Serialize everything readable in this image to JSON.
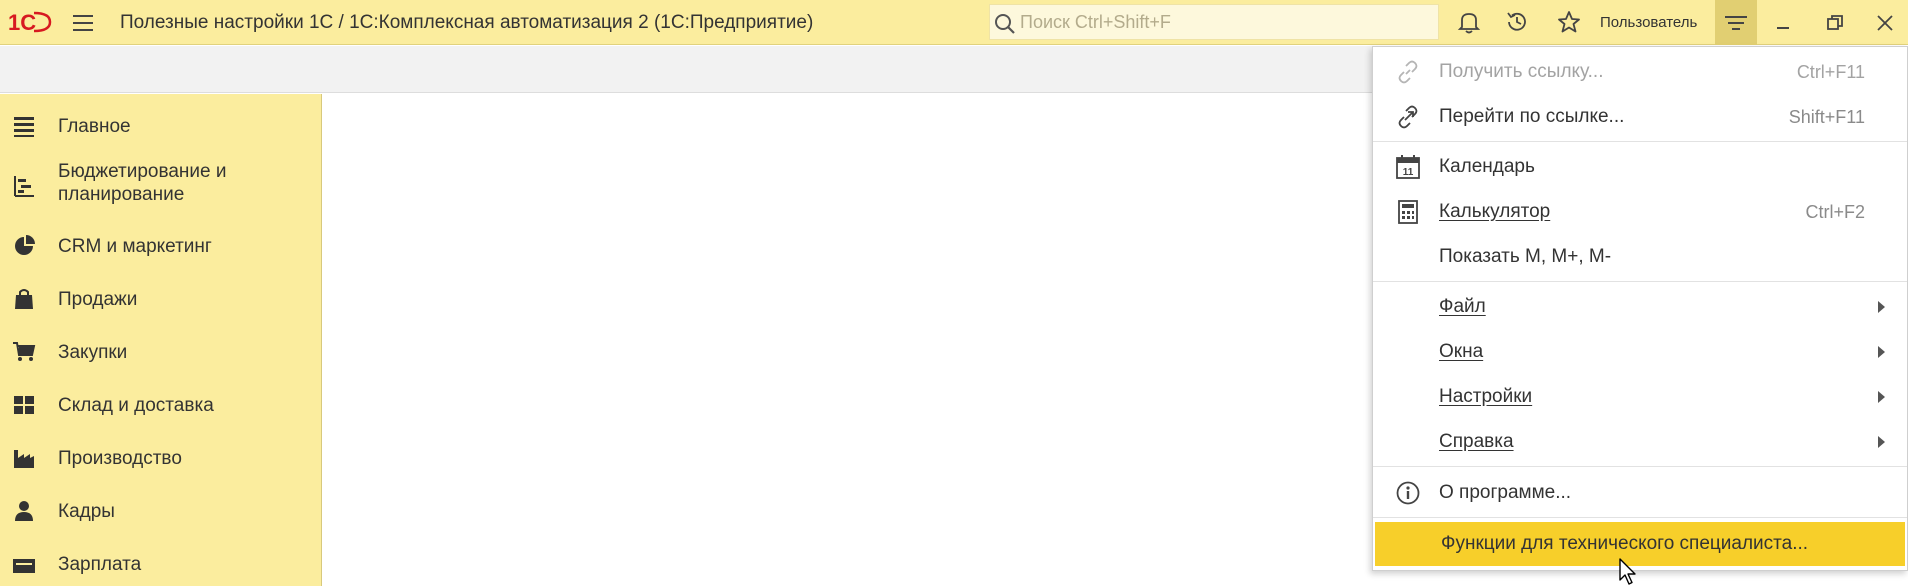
{
  "app": {
    "logo_text": "1С",
    "title": "Полезные настройки 1С / 1С:Комплексная автоматизация 2  (1С:Предприятие)"
  },
  "search": {
    "value": "",
    "placeholder": "Поиск Ctrl+Shift+F",
    "icon": "search-icon"
  },
  "toolbar": {
    "icons": [
      "bell-icon",
      "history-icon",
      "star-icon"
    ],
    "user_label": "Пользователь",
    "menu_icon": "main-menu-icon",
    "window_icons": [
      "minimize-icon",
      "restore-icon",
      "close-icon"
    ]
  },
  "sidebar": {
    "items": [
      {
        "label": "Главное",
        "icon": "list-icon"
      },
      {
        "label": "Бюджетирование и планирование",
        "icon": "budget-icon"
      },
      {
        "label": "CRM и маркетинг",
        "icon": "pie-chart-icon"
      },
      {
        "label": "Продажи",
        "icon": "shopping-bag-icon"
      },
      {
        "label": "Закупки",
        "icon": "cart-icon"
      },
      {
        "label": "Склад и доставка",
        "icon": "warehouse-icon"
      },
      {
        "label": "Производство",
        "icon": "factory-icon"
      },
      {
        "label": "Кадры",
        "icon": "person-icon"
      },
      {
        "label": "Зарплата",
        "icon": "money-icon"
      }
    ]
  },
  "menu": {
    "items": [
      {
        "label": "Получить ссылку...",
        "shortcut": "Ctrl+F11",
        "icon": "link-icon",
        "disabled": true
      },
      {
        "label": "Перейти по ссылке...",
        "shortcut": "Shift+F11",
        "icon": "follow-link-icon"
      },
      {
        "label": "Календарь",
        "shortcut": "",
        "icon": "calendar-icon",
        "calendar_day": "11"
      },
      {
        "label": "Калькулятор",
        "shortcut": "Ctrl+F2",
        "icon": "calculator-icon"
      },
      {
        "label": "Показать M, M+, M-",
        "shortcut": ""
      },
      {
        "label": "Файл",
        "submenu": true
      },
      {
        "label": "Окна",
        "submenu": true
      },
      {
        "label": "Настройки",
        "submenu": true
      },
      {
        "label": "Справка",
        "submenu": true
      },
      {
        "label": "О программе...",
        "icon": "info-icon"
      },
      {
        "label": "Функции для технического специалиста...",
        "highlighted": true
      }
    ]
  },
  "colors": {
    "title_bar": "#fbed9e",
    "sidebar": "#fbed9e",
    "menu_button_active": "#e1cf72",
    "highlight": "#f7cf2a"
  }
}
